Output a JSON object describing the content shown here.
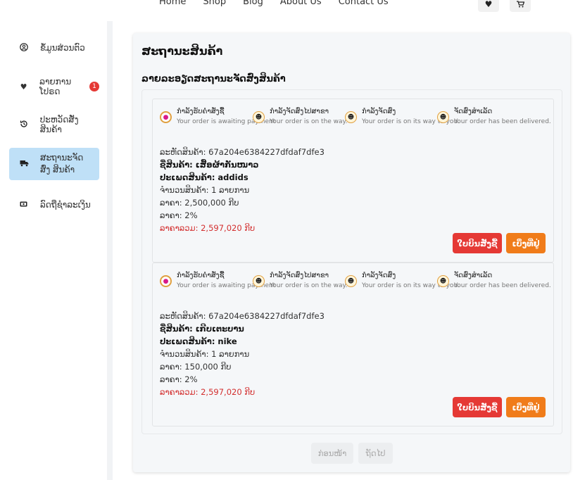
{
  "topnav": {
    "links": [
      "Home",
      "Shop",
      "Blog",
      "About Us",
      "Contact Us"
    ],
    "wishlist_icon": "heart-icon",
    "cart_icon": "cart-icon"
  },
  "sidebar": {
    "items": [
      {
        "label": "ຂໍ້ມູນສ່ວນຕົວ",
        "icon": "user-circle-icon"
      },
      {
        "label": "ລາຍການໂປຣດ",
        "icon": "heart-icon",
        "badge": "1"
      },
      {
        "label": "ປະຫວັດສັ່ງສິນຄ້າ",
        "icon": "history-icon"
      },
      {
        "label": "ສະຖານະຈັດສົ່ງ ສິນຄ້າ",
        "icon": "truck-icon",
        "active": true
      },
      {
        "label": "ລົດຖືຊໍາລະເງິນ",
        "icon": "payment-icon"
      }
    ]
  },
  "main": {
    "title": "ສະຖານະສິນຄ້າ",
    "section_title": "ລາຍລະອຽດສະຖານະຈັດສົ່ງສິນຄ້າ",
    "steps": [
      {
        "title": "ກໍາລັງຮັບຄໍາສັ່ງຊື້",
        "desc": "Your order is awaiting payment"
      },
      {
        "title": "ກໍາລັງຈັດສົ່ງໄປສາຂາ",
        "desc": "Your order is on the way."
      },
      {
        "title": "ກໍາລັງຈັດສົ່ງ",
        "desc": "Your order is on its way to you."
      },
      {
        "title": "ຈັດສົ່ງສໍາເລັດ",
        "desc": "Your order has been delivered."
      }
    ],
    "orders": [
      {
        "code": "ລະຫັດສິນຄ້າ: 67a204e6384227dfdaf7dfe3",
        "name": "ຊື່ສິນຄ້າ: ເສື້ອຜ້າກັນໜາວ",
        "type": "ປະເພດສິນຄ້າ: addids",
        "qty": "ຈໍານວນສິນຄ້າ: 1 ລາຍການ",
        "price": "ລາຄາ: 2,500,000 ກີບ",
        "tax": "ລາຄາ: 2%",
        "total": "ລາຄາລວມ: 2,597,020 ກີບ"
      },
      {
        "code": "ລະຫັດສິນຄ້າ: 67a204e6384227dfdaf7dfe3",
        "name": "ຊື່ສິນຄ້າ: ເກີບເຕະບານ",
        "type": "ປະເພດສິນຄ້າ: nike",
        "qty": "ຈໍານວນສິນຄ້າ: 1 ລາຍການ",
        "price": "ລາຄາ: 150,000 ກີບ",
        "tax": "ລາຄາ: 2%",
        "total": "ລາຄາລວມ: 2,597,020 ກີບ"
      }
    ],
    "receipt_button": "ໃບບິນສັ່ງຊື້",
    "address_button": "ເບິ່ງທີ່ຢູ່",
    "pager": {
      "prev": "ກ່ອນໜ້າ",
      "next": "ຖັດໄປ"
    }
  },
  "colors": {
    "accent_red": "#e53935",
    "accent_orange": "#f07c1a",
    "active_sidebar": "#bfe0f7",
    "total_red": "#d32f2f"
  }
}
